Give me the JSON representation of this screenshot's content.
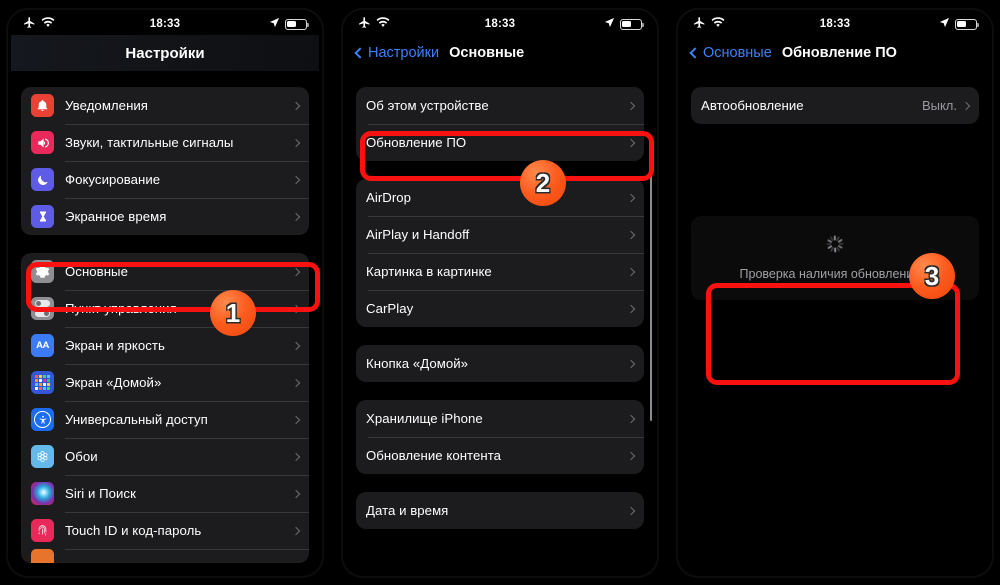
{
  "statusbar": {
    "airplane_icon": "airplane-mode-icon",
    "wifi_icon": "wifi-icon",
    "time": "18:33",
    "location_icon": "location-arrow-icon",
    "battery_icon": "battery-icon"
  },
  "panel1": {
    "title": "Настройки",
    "groups": [
      {
        "rows": [
          {
            "label": "Уведомления",
            "icon": "notifications-icon"
          },
          {
            "label": "Звуки, тактильные сигналы",
            "icon": "sounds-icon"
          },
          {
            "label": "Фокусирование",
            "icon": "focus-icon"
          },
          {
            "label": "Экранное время",
            "icon": "screen-time-icon"
          }
        ]
      },
      {
        "rows": [
          {
            "label": "Основные",
            "icon": "general-icon"
          },
          {
            "label": "Пункт управления",
            "icon": "control-center-icon"
          },
          {
            "label": "Экран и яркость",
            "icon": "display-brightness-icon"
          },
          {
            "label": "Экран «Домой»",
            "icon": "home-screen-icon"
          },
          {
            "label": "Универсальный доступ",
            "icon": "accessibility-icon"
          },
          {
            "label": "Обои",
            "icon": "wallpaper-icon"
          },
          {
            "label": "Siri и Поиск",
            "icon": "siri-icon"
          },
          {
            "label": "Touch ID и код-пароль",
            "icon": "touch-id-icon"
          }
        ]
      }
    ]
  },
  "panel2": {
    "back_label": "Настройки",
    "title": "Основные",
    "groups": [
      {
        "rows": [
          {
            "label": "Об этом устройстве"
          },
          {
            "label": "Обновление ПО"
          }
        ]
      },
      {
        "rows": [
          {
            "label": "AirDrop"
          },
          {
            "label": "AirPlay и Handoff"
          },
          {
            "label": "Картинка в картинке"
          },
          {
            "label": "CarPlay"
          }
        ]
      },
      {
        "rows": [
          {
            "label": "Кнопка «Домой»"
          }
        ]
      },
      {
        "rows": [
          {
            "label": "Хранилище iPhone"
          },
          {
            "label": "Обновление контента"
          }
        ]
      },
      {
        "rows": [
          {
            "label": "Дата и время"
          }
        ]
      }
    ]
  },
  "panel3": {
    "back_label": "Основные",
    "title": "Обновление ПО",
    "auto_update": {
      "label": "Автообновление",
      "value": "Выкл."
    },
    "loading_text": "Проверка наличия обновления...",
    "spinner_icon": "activity-spinner-icon"
  },
  "annotations": {
    "badge1": "1",
    "badge2": "2",
    "badge3": "3",
    "highlight_color": "#fc1111",
    "badge_color": "#fc5b1e"
  }
}
